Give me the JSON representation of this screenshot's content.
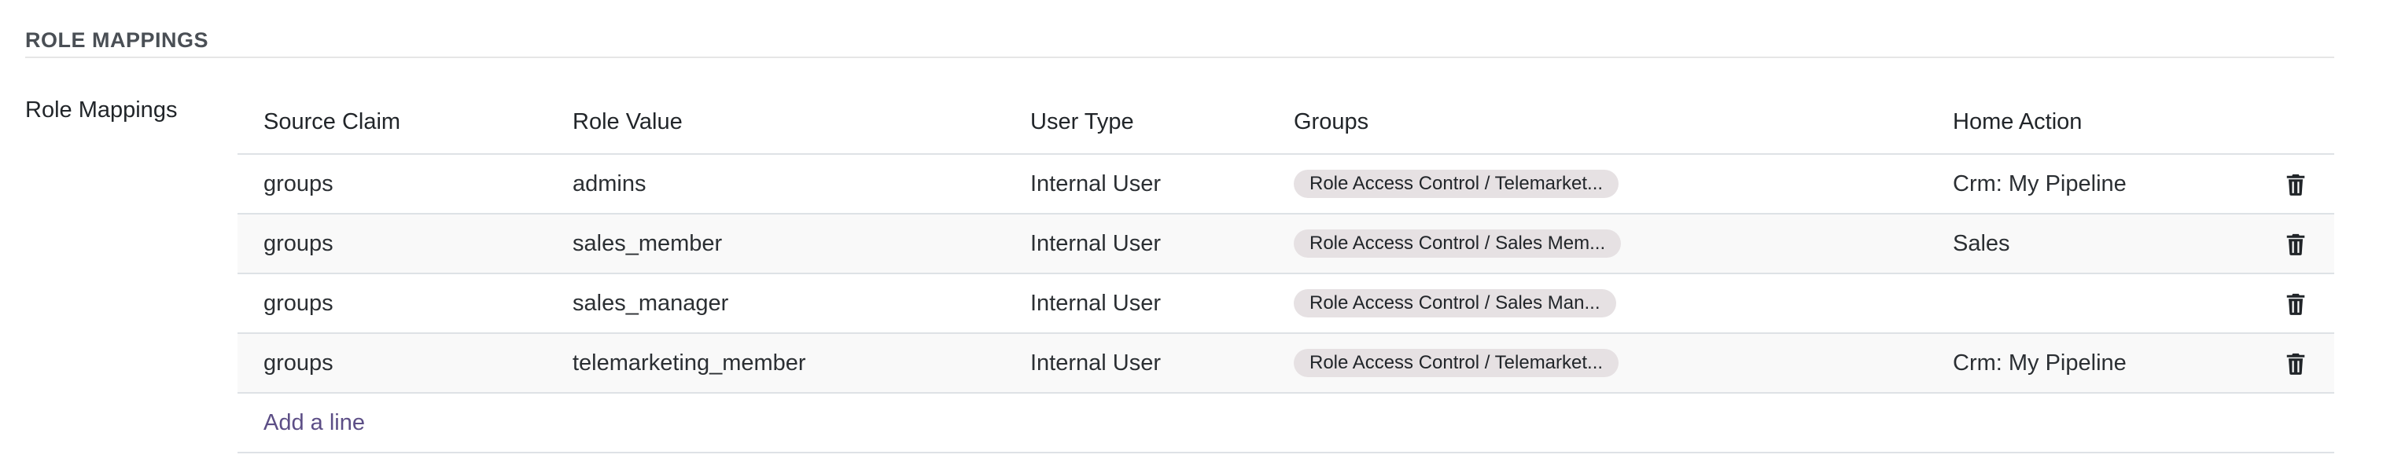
{
  "section": {
    "title": "ROLE MAPPINGS",
    "field_label": "Role Mappings"
  },
  "table": {
    "headers": [
      "Source Claim",
      "Role Value",
      "User Type",
      "Groups",
      "Home Action"
    ],
    "rows": [
      {
        "source_claim": "groups",
        "role_value": "admins",
        "user_type": "Internal User",
        "groups": "Role Access Control / Telemarket...",
        "home_action": "Crm: My Pipeline"
      },
      {
        "source_claim": "groups",
        "role_value": "sales_member",
        "user_type": "Internal User",
        "groups": "Role Access Control / Sales Mem...",
        "home_action": "Sales"
      },
      {
        "source_claim": "groups",
        "role_value": "sales_manager",
        "user_type": "Internal User",
        "groups": "Role Access Control / Sales Man...",
        "home_action": ""
      },
      {
        "source_claim": "groups",
        "role_value": "telemarketing_member",
        "user_type": "Internal User",
        "groups": "Role Access Control / Telemarket...",
        "home_action": "Crm: My Pipeline"
      }
    ],
    "add_line_label": "Add a line"
  },
  "icons": {
    "delete": "trash-icon"
  },
  "colors": {
    "badge_bg": "#e6e1e3",
    "link": "#5c4e86",
    "stripe": "#f9f9f9"
  }
}
